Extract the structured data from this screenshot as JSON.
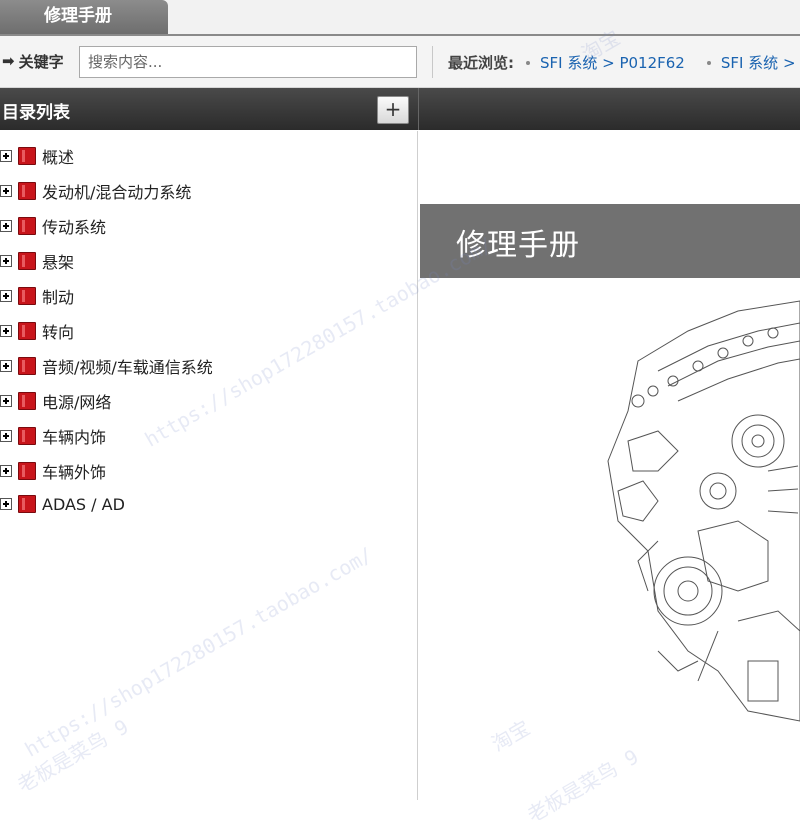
{
  "tabs": [
    {
      "label": "修理手册",
      "active": true
    }
  ],
  "search": {
    "keyword_label": "关键字",
    "placeholder": "搜索内容..."
  },
  "recent": {
    "label": "最近浏览:",
    "items": [
      "SFI 系统 > P012F62",
      "SFI 系统 >"
    ]
  },
  "toc": {
    "title": "目录列表",
    "expand_button": "+",
    "items": [
      {
        "label": "概述"
      },
      {
        "label": "发动机/混合动力系统"
      },
      {
        "label": "传动系统"
      },
      {
        "label": "悬架"
      },
      {
        "label": "制动"
      },
      {
        "label": "转向"
      },
      {
        "label": "音频/视频/车载通信系统"
      },
      {
        "label": "电源/网络"
      },
      {
        "label": "车辆内饰"
      },
      {
        "label": "车辆外饰"
      },
      {
        "label": "ADAS / AD"
      }
    ]
  },
  "content": {
    "banner_title": "修理手册"
  },
  "watermarks": [
    "https://shop172280157.taobao.com/",
    "淘宝",
    "老板是菜鸟 9"
  ],
  "colors": {
    "header_dark": "#2b2b2b",
    "tab_gray": "#7a7a7a",
    "link_blue": "#1a63b0",
    "book_red": "#c8151b",
    "banner_gray": "#717171"
  }
}
